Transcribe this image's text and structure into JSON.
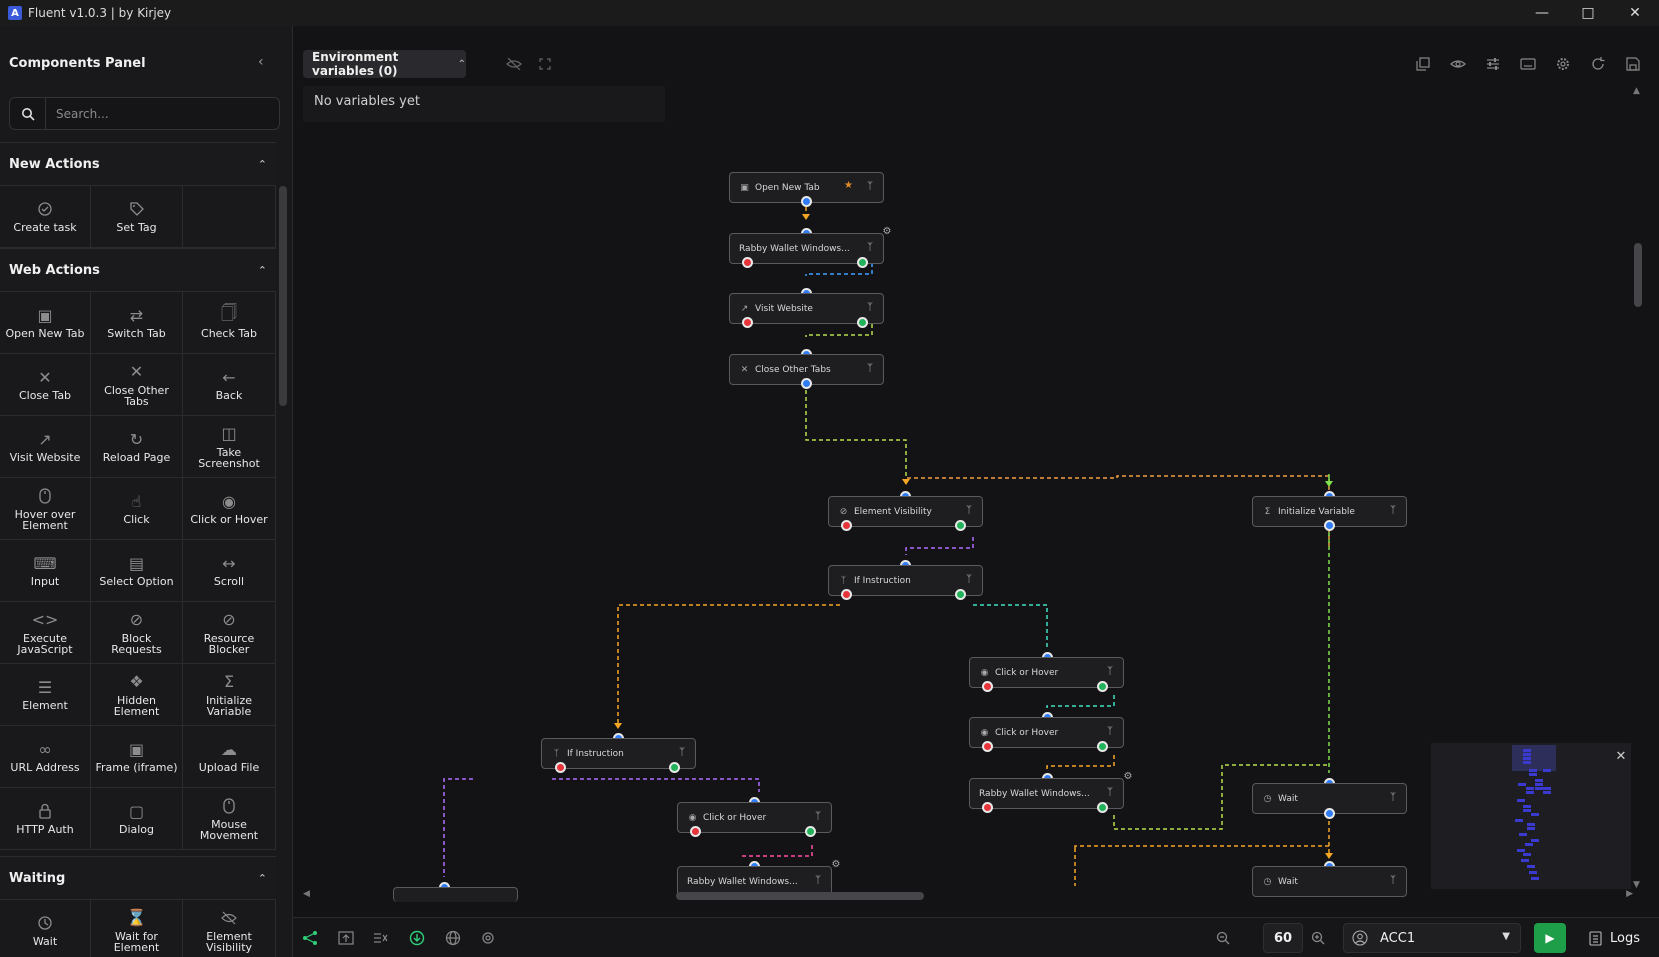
{
  "window": {
    "title": "Fluent v1.0.3 | by Kirjey",
    "logo_letter": "A"
  },
  "sidebar": {
    "panel_title": "Components Panel",
    "search_placeholder": "Search...",
    "sections": [
      {
        "title": "New Actions",
        "items": [
          "Create task",
          "Set Tag"
        ]
      },
      {
        "title": "Web Actions",
        "items": [
          "Open New Tab",
          "Switch Tab",
          "Check Tab",
          "Close Tab",
          "Close Other Tabs",
          "Back",
          "Visit Website",
          "Reload Page",
          "Take Screenshot",
          "Hover over Element",
          "Click",
          "Click or Hover",
          "Input",
          "Select Option",
          "Scroll",
          "Execute JavaScript",
          "Block Requests",
          "Resource Blocker",
          "Element",
          "Hidden Element",
          "Initialize Variable",
          "URL Address",
          "Frame (iframe)",
          "Upload File",
          "HTTP Auth",
          "Dialog",
          "Mouse Movement"
        ]
      },
      {
        "title": "Waiting",
        "items": [
          "Wait",
          "Wait for Element",
          "Element Visibility"
        ]
      }
    ]
  },
  "env": {
    "header": "Environment variables (0)",
    "empty_text": "No variables yet"
  },
  "nodes": {
    "n1": "Open New Tab",
    "n2": "Rabby Wallet Windows...",
    "n3": "Visit Website",
    "n4": "Close Other Tabs",
    "n5": "Element Visibility",
    "n6": "If Instruction",
    "n7": "Initialize Variable",
    "n8": "Click or Hover",
    "n9": "Click or Hover",
    "n10": "Rabby Wallet Windows...",
    "n11": "If Instruction",
    "n12": "Click or Hover",
    "n13": "Rabby Wallet Windows...",
    "n14": "Wait",
    "n15": "Wait"
  },
  "bottom": {
    "zoom": "60",
    "account": "ACC1",
    "logs": "Logs"
  },
  "colors": {
    "accent_run": "#1f9e4a",
    "port_in": "#2f7cf6",
    "port_error": "#e5353b",
    "port_success": "#21b25a"
  }
}
